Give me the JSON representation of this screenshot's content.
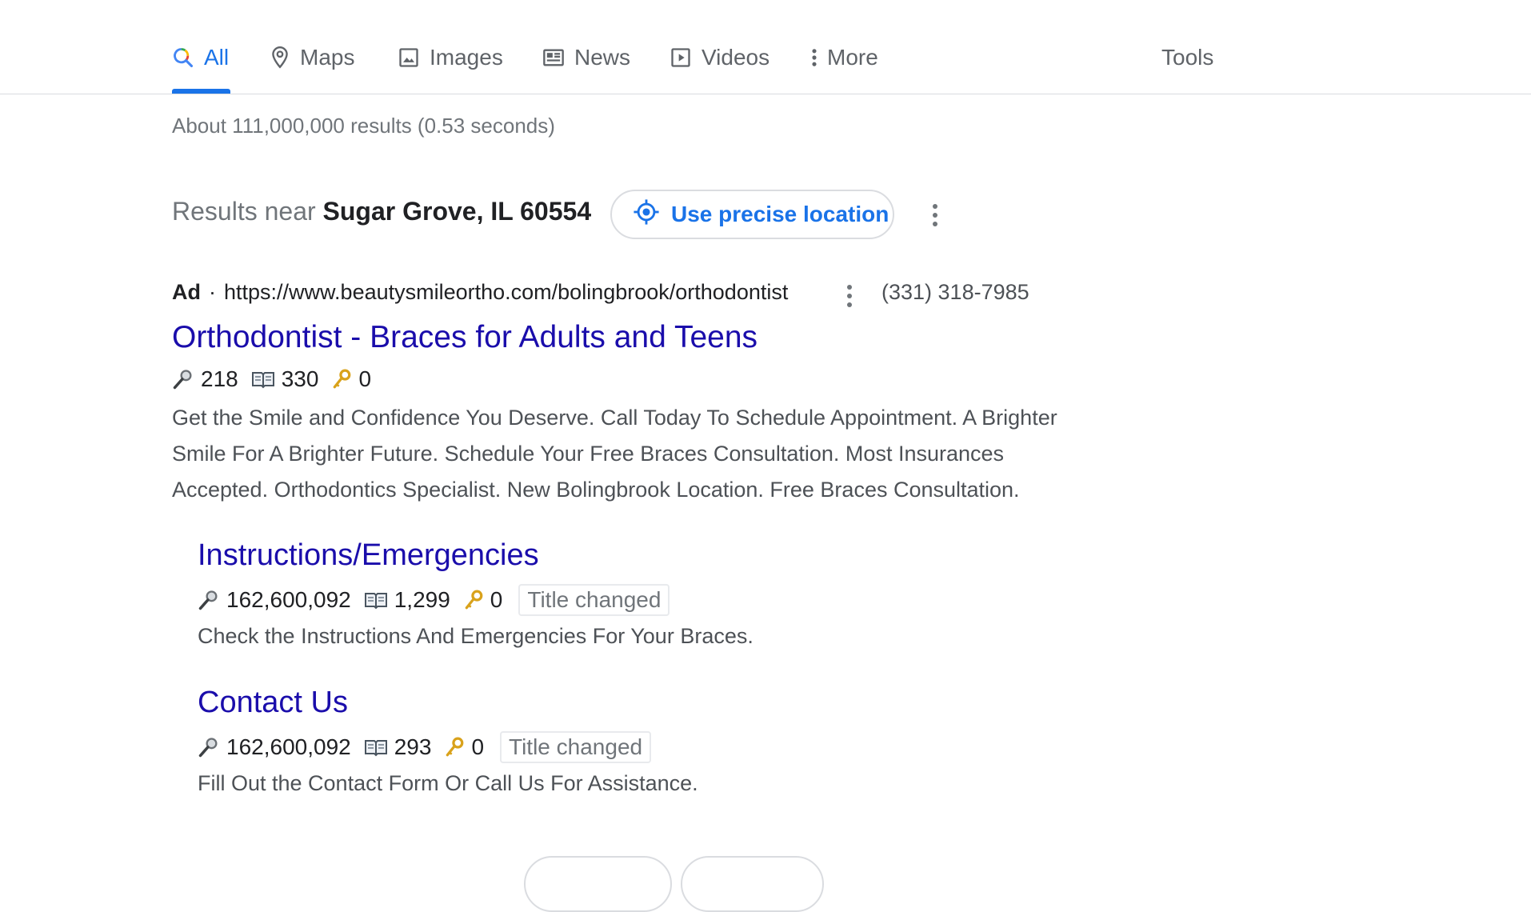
{
  "tabs": [
    {
      "label": "All",
      "icon": "search-icon",
      "active": true
    },
    {
      "label": "Maps",
      "icon": "map-pin-icon"
    },
    {
      "label": "Images",
      "icon": "image-icon"
    },
    {
      "label": "News",
      "icon": "news-icon"
    },
    {
      "label": "Videos",
      "icon": "video-icon"
    },
    {
      "label": "More",
      "icon": "more-vertical-icon"
    }
  ],
  "tools_label": "Tools",
  "result_stats": "About 111,000,000 results (0.53 seconds)",
  "location": {
    "prefix": "Results near",
    "place": "Sugar Grove, IL 60554",
    "button_label": "Use precise location"
  },
  "ad": {
    "label": "Ad",
    "separator": "·",
    "url": "https://www.beautysmileortho.com/bolingbrook/orthodontist",
    "phone": "(331) 318-7985",
    "title": "Orthodontist - Braces for Adults and Teens",
    "metrics": {
      "search": "218",
      "book": "330",
      "key": "0"
    },
    "description_lines": [
      "Get the Smile and Confidence You Deserve. Call Today To Schedule Appointment. A Brighter",
      "Smile For A Brighter Future. Schedule Your Free Braces Consultation. Most Insurances",
      "Accepted. Orthodontics Specialist. New Bolingbrook Location. Free Braces Consultation."
    ],
    "sitelinks": [
      {
        "title": "Instructions/Emergencies",
        "metrics": {
          "search": "162,600,092",
          "book": "1,299",
          "key": "0"
        },
        "badge": "Title changed",
        "description": "Check the Instructions And Emergencies For Your Braces."
      },
      {
        "title": "Contact Us",
        "metrics": {
          "search": "162,600,092",
          "book": "293",
          "key": "0"
        },
        "badge": "Title changed",
        "description": "Fill Out the Contact Form Or Call Us For Assistance."
      }
    ]
  },
  "colors": {
    "link": "#1a0dab",
    "accent": "#1a73e8",
    "muted": "#70757a",
    "text": "#202124"
  }
}
